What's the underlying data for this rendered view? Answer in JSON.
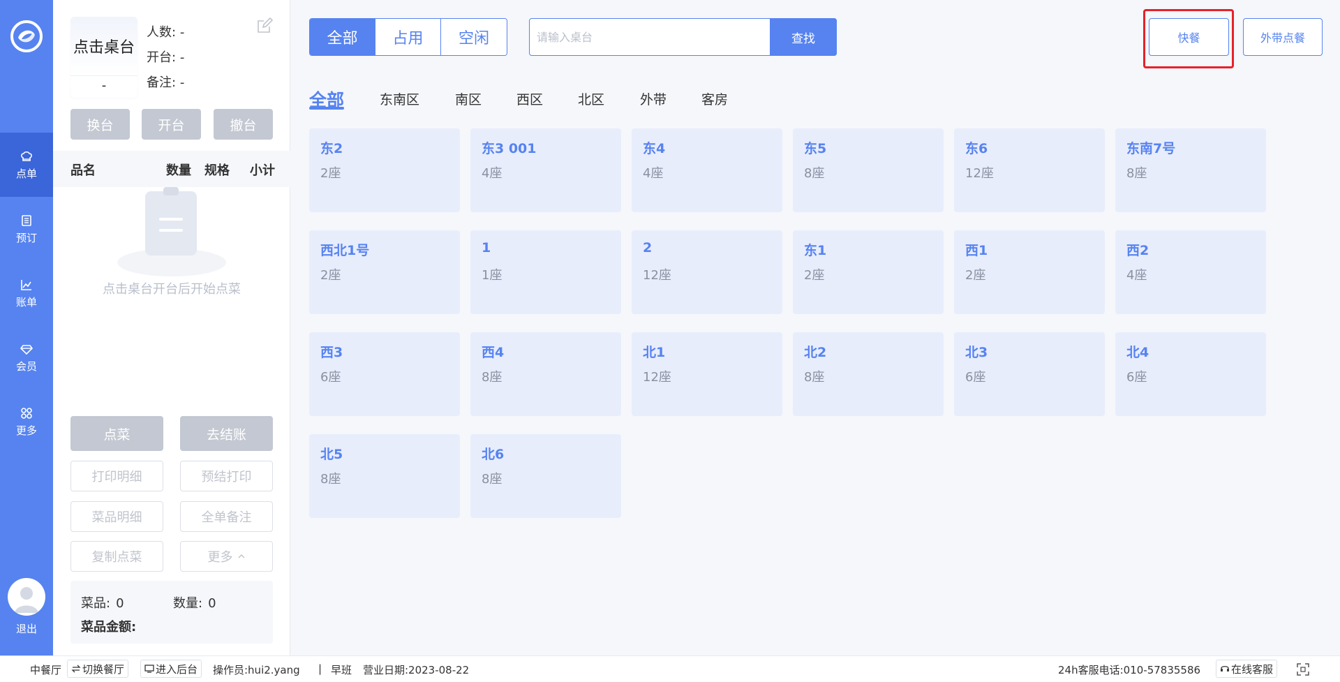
{
  "nav": {
    "items": [
      {
        "label": "点单",
        "icon": "chef-hat-icon"
      },
      {
        "label": "预订",
        "icon": "book-icon"
      },
      {
        "label": "账单",
        "icon": "chart-icon"
      },
      {
        "label": "会员",
        "icon": "diamond-icon"
      },
      {
        "label": "更多",
        "icon": "grid-icon"
      }
    ],
    "logout": "退出"
  },
  "order_panel": {
    "table_card": {
      "title": "点击桌台",
      "number": "-"
    },
    "info": {
      "guests_label": "人数:",
      "guests_value": "-",
      "open_label": "开台:",
      "open_value": "-",
      "remark_label": "备注:",
      "remark_value": "-"
    },
    "actions": {
      "change": "换台",
      "open": "开台",
      "cancel": "撤台"
    },
    "columns": {
      "name": "品名",
      "qty": "数量",
      "spec": "规格",
      "subtotal": "小计"
    },
    "empty_text": "点击桌台开台后开始点菜",
    "buttons": {
      "order": "点菜",
      "checkout": "去结账",
      "print_detail": "打印明细",
      "pre_print": "预结打印",
      "dish_detail": "菜品明细",
      "order_remark": "全单备注",
      "copy_order": "复制点菜",
      "more": "更多"
    },
    "summary": {
      "dishes_label": "菜品:",
      "dishes_value": "0",
      "qty_label": "数量:",
      "qty_value": "0",
      "amount_label": "菜品金额:"
    }
  },
  "main": {
    "filters": [
      "全部",
      "占用",
      "空闲"
    ],
    "search": {
      "placeholder": "请输入桌台",
      "button": "查找"
    },
    "quick_meal": "快餐",
    "takeout": "外带点餐",
    "areas": [
      "全部",
      "东南区",
      "南区",
      "西区",
      "北区",
      "外带",
      "客房"
    ],
    "tables": [
      {
        "name": "东2",
        "seats": "2座"
      },
      {
        "name": "东3 001",
        "seats": "4座"
      },
      {
        "name": "东4",
        "seats": "4座"
      },
      {
        "name": "东5",
        "seats": "8座"
      },
      {
        "name": "东6",
        "seats": "12座"
      },
      {
        "name": "东南7号",
        "seats": "8座"
      },
      {
        "name": "西北1号",
        "seats": "2座"
      },
      {
        "name": "1",
        "seats": "1座"
      },
      {
        "name": "2",
        "seats": "12座"
      },
      {
        "name": "东1",
        "seats": "2座"
      },
      {
        "name": "西1",
        "seats": "2座"
      },
      {
        "name": "西2",
        "seats": "4座"
      },
      {
        "name": "西3",
        "seats": "6座"
      },
      {
        "name": "西4",
        "seats": "8座"
      },
      {
        "name": "北1",
        "seats": "12座"
      },
      {
        "name": "北2",
        "seats": "8座"
      },
      {
        "name": "北3",
        "seats": "6座"
      },
      {
        "name": "北4",
        "seats": "6座"
      },
      {
        "name": "北5",
        "seats": "8座"
      },
      {
        "name": "北6",
        "seats": "8座"
      }
    ]
  },
  "status_bar": {
    "restaurant": "中餐厅",
    "switch": "切换餐厅",
    "backend": "进入后台",
    "operator": "操作员:hui2.yang",
    "separator": "|",
    "shift": "早班",
    "business_date": "营业日期:2023-08-22",
    "hotline": "24h客服电话:010-57835586",
    "online_service": "在线客服"
  },
  "colors": {
    "primary": "#5683f0",
    "rail_active": "#3b66d9",
    "card_bg": "#e8edfc",
    "highlight": "#e5222a",
    "disabled": "#c3c8d2"
  }
}
